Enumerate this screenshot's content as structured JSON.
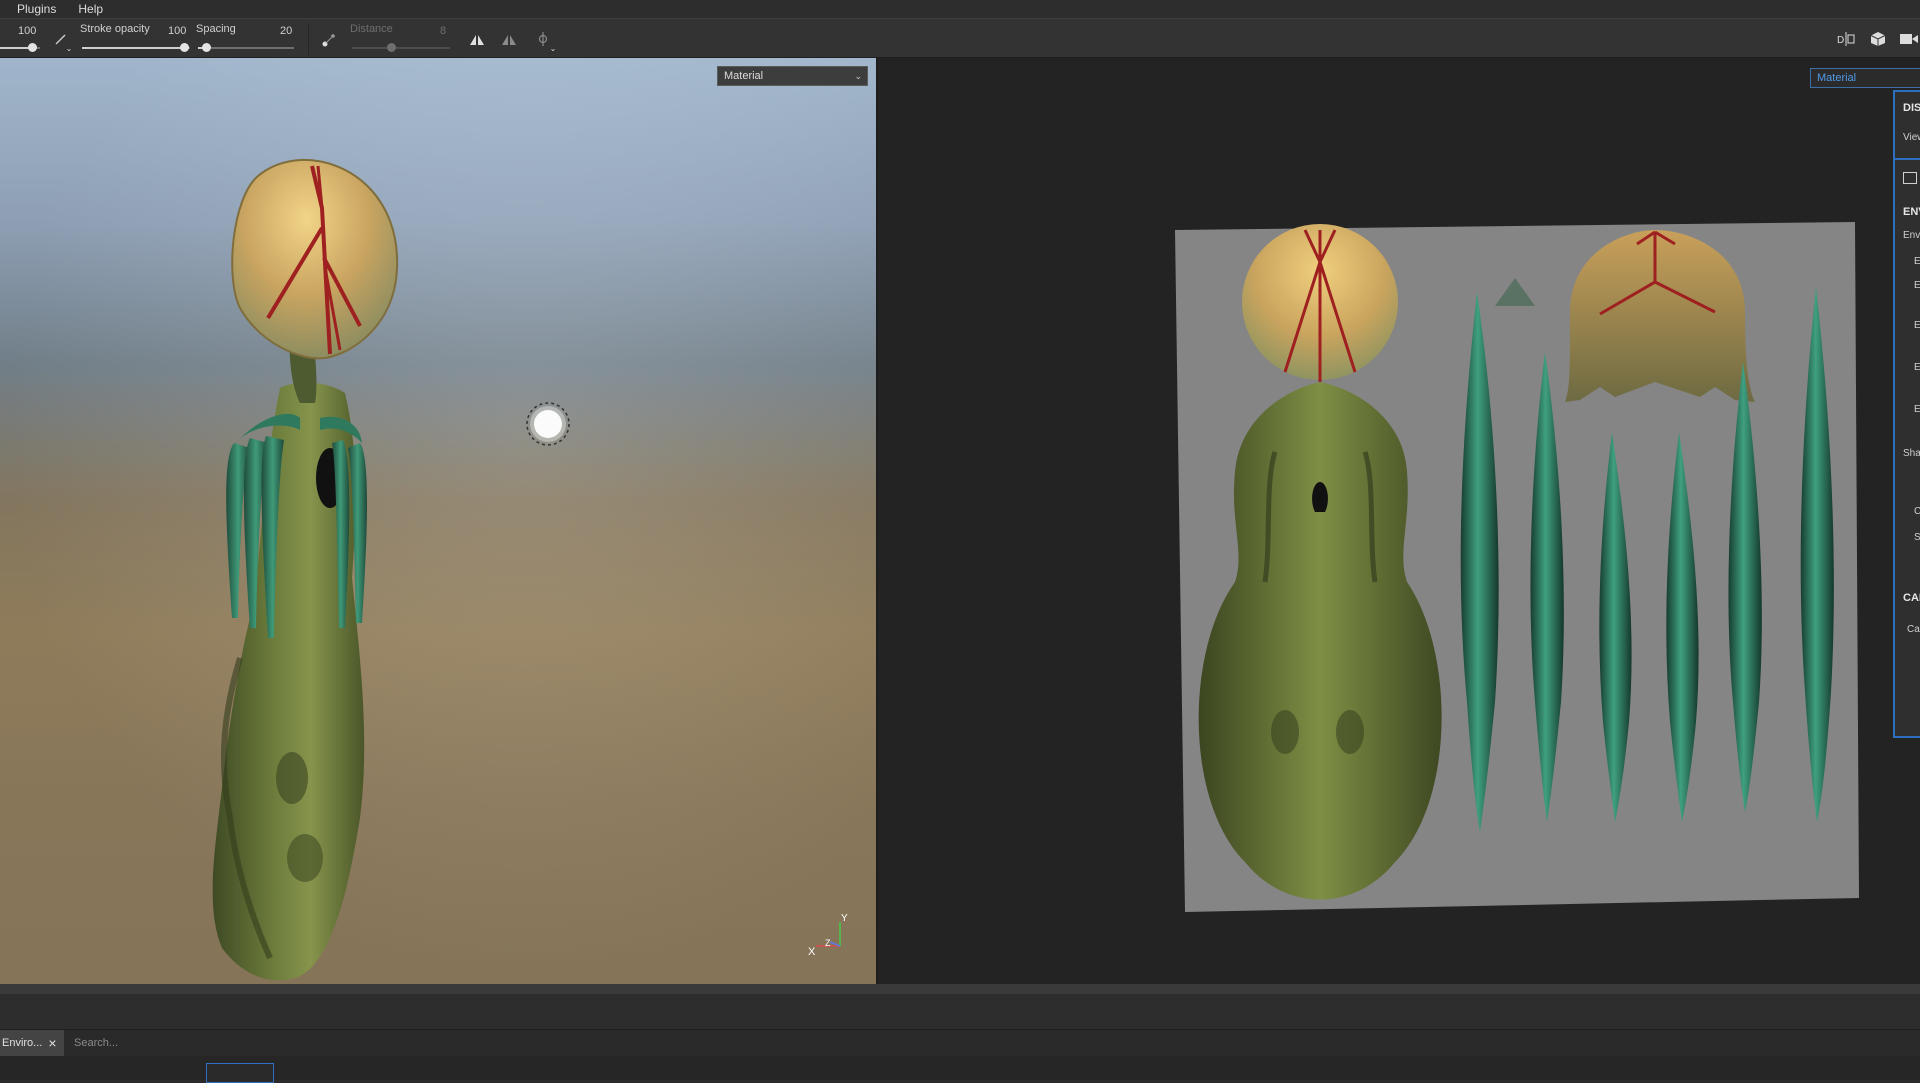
{
  "menu": {
    "items": [
      "Plugins",
      "Help"
    ]
  },
  "toolbar": {
    "size_value": "100",
    "stroke_opacity_label": "Stroke opacity",
    "stroke_opacity_value": "100",
    "spacing_label": "Spacing",
    "spacing_value": "20",
    "distance_label": "Distance",
    "distance_value": "8"
  },
  "viewport3d": {
    "display_mode": "Material",
    "axis_labels": {
      "x": "X",
      "y": "Y",
      "z": "Z"
    }
  },
  "viewport2d": {
    "display_mode": "Material"
  },
  "right_panel": {
    "section_display": "DIS",
    "view_label": "View",
    "section_environment": "ENV",
    "env_label": "Env",
    "rows": [
      "E",
      "E",
      "E",
      "E",
      "E"
    ],
    "shadow_label": "Sha",
    "row_c": "C",
    "row_s": "S",
    "section_camera": "CAI",
    "camera_label": "Ca"
  },
  "shelf": {
    "tab_label": "Enviro...",
    "search_placeholder": "Search..."
  },
  "colors": {
    "accent": "#2f6fbf",
    "seam_red": "#a52222",
    "alien_green": "#5a6e30",
    "horn_teal": "#2e7a60"
  }
}
